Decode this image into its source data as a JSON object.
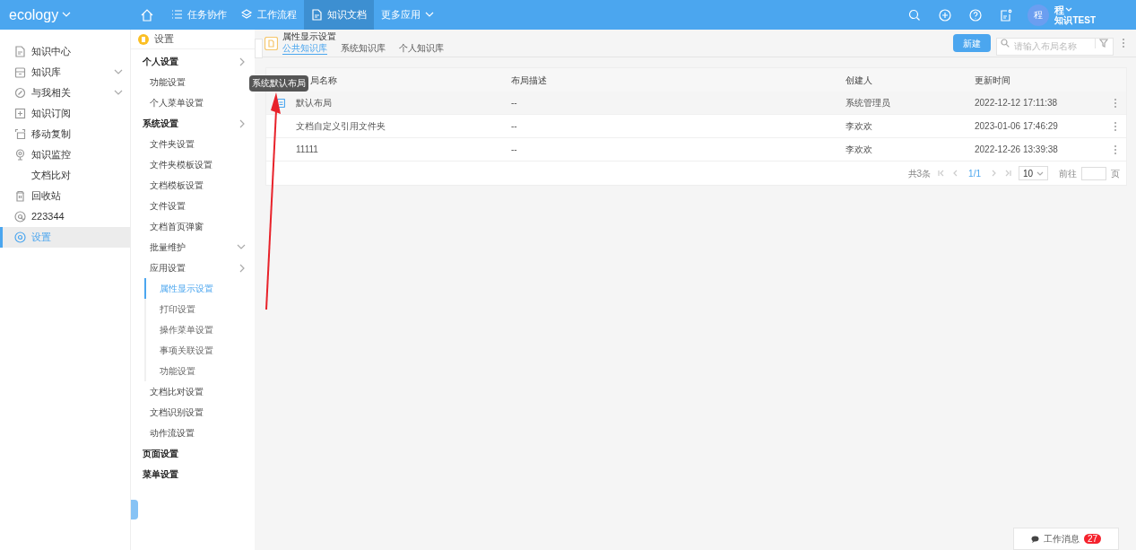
{
  "topbar": {
    "brand": "ecology",
    "nav": [
      {
        "label": "任务协作",
        "selected": false
      },
      {
        "label": "工作流程",
        "selected": false
      },
      {
        "label": "知识文档",
        "selected": true
      },
      {
        "label": "更多应用",
        "selected": false
      }
    ],
    "avatar": "程",
    "user_name": "程",
    "user_dept": "知识TEST"
  },
  "sidebar": {
    "items": [
      {
        "label": "知识中心",
        "expandable": false,
        "selected": false
      },
      {
        "label": "知识库",
        "expandable": true,
        "selected": false
      },
      {
        "label": "与我相关",
        "expandable": true,
        "selected": false
      },
      {
        "label": "知识订阅",
        "expandable": false,
        "selected": false
      },
      {
        "label": "移动复制",
        "expandable": false,
        "selected": false
      },
      {
        "label": "知识监控",
        "expandable": false,
        "selected": false
      },
      {
        "label": "文档比对",
        "expandable": false,
        "selected": false
      },
      {
        "label": "回收站",
        "expandable": false,
        "selected": false
      },
      {
        "label": "223344",
        "expandable": false,
        "selected": false
      },
      {
        "label": "设置",
        "expandable": false,
        "selected": true
      }
    ]
  },
  "settings_menu": {
    "title": "设置",
    "items": [
      {
        "label": "个人设置",
        "kind": "heading-toggle",
        "selected": false,
        "children": [
          {
            "label": "功能设置",
            "kind": "item",
            "selected": false
          },
          {
            "label": "个人菜单设置",
            "kind": "item",
            "selected": false
          }
        ]
      },
      {
        "label": "系统设置",
        "kind": "heading-toggle",
        "selected": false,
        "children": [
          {
            "label": "文件夹设置",
            "kind": "item",
            "selected": false
          },
          {
            "label": "文件夹模板设置",
            "kind": "item",
            "selected": false
          },
          {
            "label": "文档模板设置",
            "kind": "item",
            "selected": false
          },
          {
            "label": "文件设置",
            "kind": "item",
            "selected": false
          },
          {
            "label": "文档首页弹窗",
            "kind": "item",
            "selected": false
          },
          {
            "label": "批量维护",
            "kind": "item-dropdown",
            "selected": false
          },
          {
            "label": "应用设置",
            "kind": "item-toggle",
            "selected": false,
            "children": [
              {
                "label": "属性显示设置",
                "kind": "subitem",
                "selected": true
              },
              {
                "label": "打印设置",
                "kind": "subitem",
                "selected": false
              },
              {
                "label": "操作菜单设置",
                "kind": "subitem",
                "selected": false
              },
              {
                "label": "事项关联设置",
                "kind": "subitem",
                "selected": false
              },
              {
                "label": "功能设置",
                "kind": "subitem",
                "selected": false
              }
            ]
          },
          {
            "label": "文档比对设置",
            "kind": "item",
            "selected": false
          },
          {
            "label": "文档识别设置",
            "kind": "item",
            "selected": false
          },
          {
            "label": "动作流设置",
            "kind": "item",
            "selected": false
          }
        ]
      },
      {
        "label": "页面设置",
        "kind": "heading",
        "selected": false
      },
      {
        "label": "菜单设置",
        "kind": "heading",
        "selected": false
      }
    ]
  },
  "page": {
    "title": "属性显示设置",
    "tabs": [
      {
        "label": "公共知识库",
        "selected": true
      },
      {
        "label": "系统知识库",
        "selected": false
      },
      {
        "label": "个人知识库",
        "selected": false
      }
    ],
    "new_button": "新建",
    "search": {
      "placeholder": "请输入布局名称"
    }
  },
  "table": {
    "columns": [
      "局名称",
      "布局描述",
      "创建人",
      "更新时间"
    ],
    "rows": [
      {
        "system_default": true,
        "hovered": true,
        "cells": [
          "默认布局",
          "--",
          "系统管理员",
          "2022-12-12 17:11:38"
        ]
      },
      {
        "system_default": false,
        "hovered": false,
        "cells": [
          "文档自定义引用文件夹",
          "--",
          "李欢欢",
          "2023-01-06 17:46:29"
        ]
      },
      {
        "system_default": false,
        "hovered": false,
        "cells": [
          "11111",
          "--",
          "李欢欢",
          "2022-12-26 13:39:38"
        ]
      }
    ],
    "tooltip": "系统默认布局",
    "pagination": {
      "total": "共3条",
      "page": "1/1",
      "page_size": "10",
      "goto_label": "前往",
      "page_suffix": "页"
    }
  },
  "work_messages": {
    "label": "工作消息",
    "count": "27"
  }
}
